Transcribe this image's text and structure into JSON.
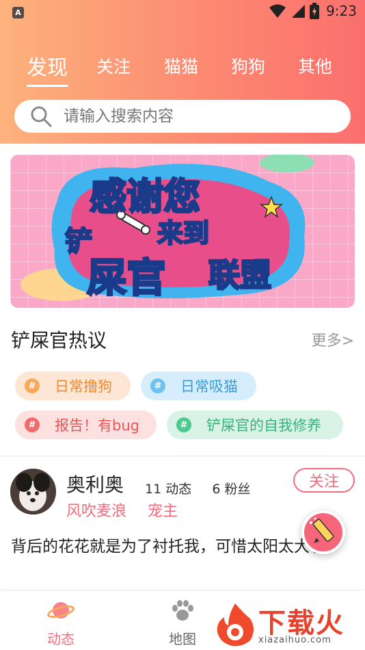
{
  "status_bar": {
    "left_icon": "A",
    "time": "9:23",
    "icons": [
      "wifi-icon",
      "signal-icon",
      "battery-icon"
    ]
  },
  "tabs": [
    {
      "label": "发现",
      "active": true
    },
    {
      "label": "关注",
      "active": false
    },
    {
      "label": "猫猫",
      "active": false
    },
    {
      "label": "狗狗",
      "active": false
    },
    {
      "label": "其他",
      "active": false
    }
  ],
  "search": {
    "placeholder": "请输入搜索内容",
    "value": ""
  },
  "banner": {
    "line1": "感谢您",
    "line2a": "铲",
    "line2b": "来到",
    "line3a": "屎官",
    "line3b": "联盟"
  },
  "hot_topics": {
    "title": "铲屎官热议",
    "more_label": "更多>",
    "tags": [
      {
        "label": "日常撸狗",
        "icon": "#"
      },
      {
        "label": "日常吸猫",
        "icon": "#"
      },
      {
        "label": "报告！有bug",
        "icon": "#"
      },
      {
        "label": "铲屎官的自我修养",
        "icon": "#"
      }
    ]
  },
  "post": {
    "author": "奥利奥",
    "posts_count": "11 动态",
    "fans_count": "6 粉丝",
    "tag1": "风吹麦浪",
    "tag2": "宠主",
    "follow_label": "关注",
    "text": "背后的花花就是为了衬托我，可惜太阳太大了"
  },
  "bottom_nav": [
    {
      "label": "动态",
      "active": true,
      "icon": "planet-icon"
    },
    {
      "label": "地图",
      "active": false,
      "icon": "paw-icon"
    }
  ],
  "watermark": {
    "text": "下载火",
    "url": "xiazaihuo.com"
  },
  "colors": {
    "accent": "#f56a7a",
    "header_start": "#fdb27c",
    "header_end": "#fb6f6d"
  }
}
